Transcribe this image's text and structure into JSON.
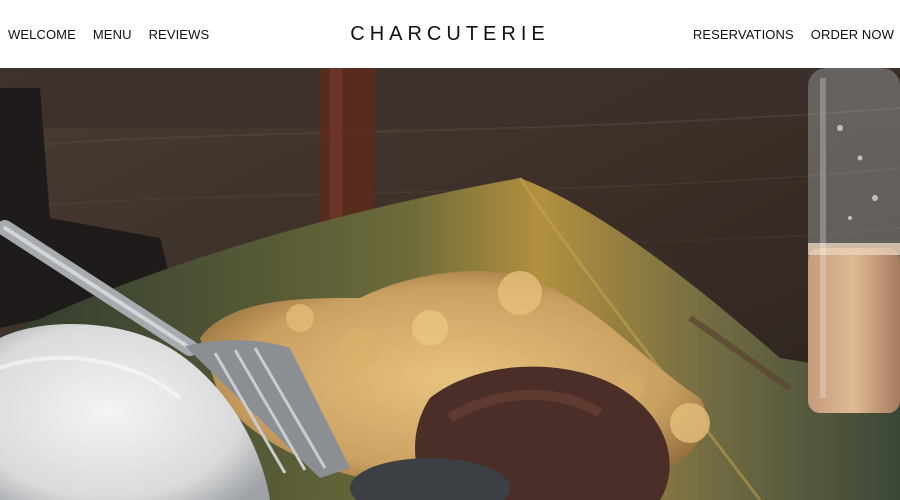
{
  "nav": {
    "left_links": [
      "WELCOME",
      "MENU",
      "REVIEWS"
    ],
    "brand": "CHARCUTERIE",
    "right_links": [
      "RESERVATIONS",
      "ORDER NOW"
    ]
  },
  "hero": {
    "image": "food-photo-rice-scrambled-egg-banana-leaf"
  },
  "colors": {
    "nav_background": "#ffffff",
    "nav_text": "#111111"
  }
}
